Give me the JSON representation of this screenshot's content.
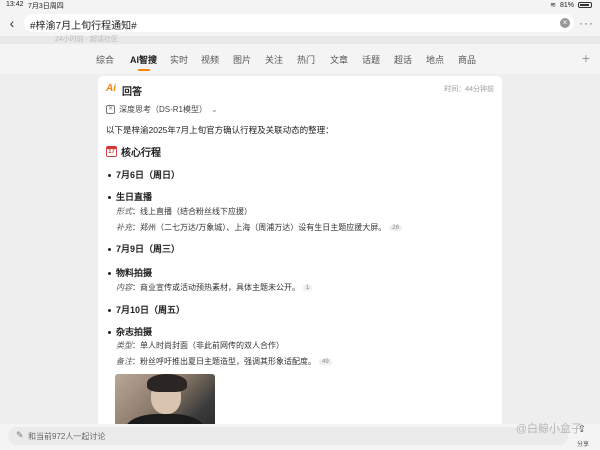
{
  "status_bar": {
    "time": "13:42",
    "date": "7月3日周四",
    "battery": "81%"
  },
  "search": {
    "query": "#梓渝7月上旬行程通知#"
  },
  "peek_text": "24小时前 · 超话社区",
  "tabs": [
    {
      "label": "综合"
    },
    {
      "label": "AI智搜"
    },
    {
      "label": "实时"
    },
    {
      "label": "视频"
    },
    {
      "label": "图片"
    },
    {
      "label": "关注"
    },
    {
      "label": "热门"
    },
    {
      "label": "文章"
    },
    {
      "label": "话题"
    },
    {
      "label": "超话"
    },
    {
      "label": "地点"
    },
    {
      "label": "商品"
    }
  ],
  "card": {
    "logo": "Ai",
    "answer_label": "回答",
    "time": "时间：44分钟前",
    "model": "深度思考（DS-R1模型）",
    "intro": "以下是梓渝2025年7月上旬官方确认行程及关联动态的整理：",
    "section_title": "核心行程",
    "schedule": [
      {
        "date": "7月6日（周日）",
        "event": "生日直播",
        "details": [
          {
            "key": "形式",
            "value": "：线上直播（结合粉丝线下应援）",
            "ref": ""
          },
          {
            "key": "补充",
            "value": "：郑州（二七万达/万象城）、上海（周浦万达）设有生日主题应援大屏。",
            "ref": "26"
          }
        ]
      },
      {
        "date": "7月9日（周三）",
        "event": "物料拍摄",
        "details": [
          {
            "key": "内容",
            "value": "：商业宣传或活动预热素材，具体主题未公开。",
            "ref": "1"
          }
        ]
      },
      {
        "date": "7月10日（周五）",
        "event": "杂志拍摄",
        "details": [
          {
            "key": "类型",
            "value": "：单人时尚封面（非此前网传的双人合作）",
            "ref": ""
          },
          {
            "key": "备注",
            "value": "：粉丝呼吁推出夏日主题造型，强调其形象适配度。",
            "ref": "49"
          }
        ]
      }
    ]
  },
  "bottom": {
    "comment_placeholder": "和当前972人一起讨论",
    "share_label": "分享",
    "watermark": "@白鲸小盒子"
  },
  "colors": {
    "accent": "#ff8200",
    "background": "#eeeeee",
    "card": "#ffffff"
  }
}
